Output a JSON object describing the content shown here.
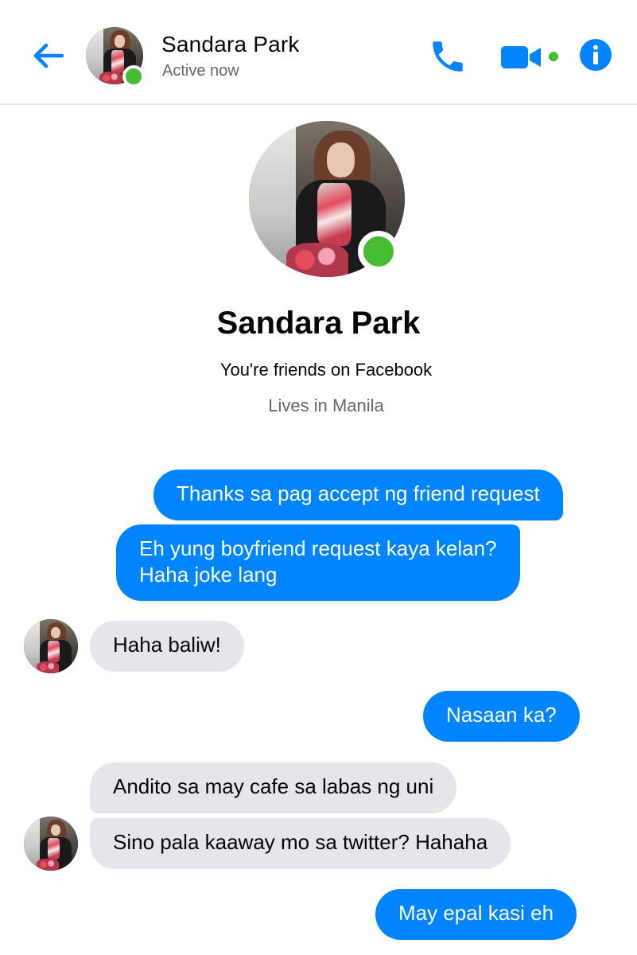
{
  "header": {
    "name": "Sandara Park",
    "status": "Active now",
    "icons": {
      "back": "back-arrow-icon",
      "call": "phone-icon",
      "video": "video-camera-icon",
      "info": "info-icon"
    }
  },
  "profile": {
    "name": "Sandara Park",
    "friendship": "You're friends on Facebook",
    "location": "Lives in Manila"
  },
  "messages": [
    {
      "from": "me",
      "text": "Thanks sa pag accept ng friend request"
    },
    {
      "from": "me",
      "lines": [
        "Eh yung boyfriend request kaya kelan?",
        "Haha joke lang"
      ]
    },
    {
      "from": "them",
      "text": "Haha baliw!"
    },
    {
      "from": "me",
      "text": "Nasaan ka?"
    },
    {
      "from": "them",
      "text": "Andito sa may cafe sa labas ng uni"
    },
    {
      "from": "them",
      "text": "Sino pala kaaway mo sa twitter? Hahaha"
    },
    {
      "from": "me",
      "text": "May epal kasi eh"
    }
  ],
  "colors": {
    "accent": "#0084ff",
    "online": "#44bd32",
    "incoming_bubble": "#e4e6eb",
    "secondary_text": "#65676b"
  }
}
